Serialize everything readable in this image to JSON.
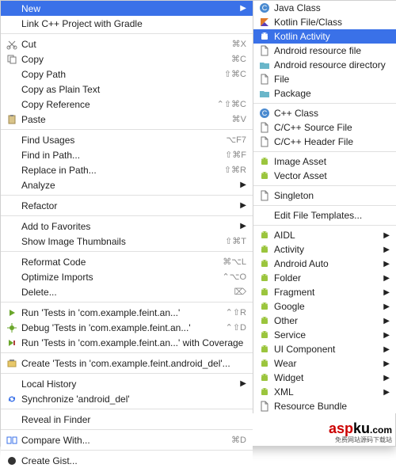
{
  "main": {
    "groups": [
      [
        {
          "key": "new",
          "label": "New",
          "icon": "blank",
          "highlight": true,
          "arrow": true
        },
        {
          "key": "link-cpp",
          "label": "Link C++ Project with Gradle",
          "icon": "blank"
        }
      ],
      [
        {
          "key": "cut",
          "label": "Cut",
          "icon": "scissors",
          "shortcut": "⌘X"
        },
        {
          "key": "copy",
          "label": "Copy",
          "icon": "copy",
          "shortcut": "⌘C"
        },
        {
          "key": "copy-path",
          "label": "Copy Path",
          "icon": "blank",
          "shortcut": "⇧⌘C"
        },
        {
          "key": "copy-plain",
          "label": "Copy as Plain Text",
          "icon": "blank"
        },
        {
          "key": "copy-ref",
          "label": "Copy Reference",
          "icon": "blank",
          "shortcut": "⌃⇧⌘C"
        },
        {
          "key": "paste",
          "label": "Paste",
          "icon": "paste",
          "shortcut": "⌘V"
        }
      ],
      [
        {
          "key": "find-usages",
          "label": "Find Usages",
          "icon": "blank",
          "shortcut": "⌥F7"
        },
        {
          "key": "find-in-path",
          "label": "Find in Path...",
          "icon": "blank",
          "shortcut": "⇧⌘F"
        },
        {
          "key": "replace-in-path",
          "label": "Replace in Path...",
          "icon": "blank",
          "shortcut": "⇧⌘R"
        },
        {
          "key": "analyze",
          "label": "Analyze",
          "icon": "blank",
          "arrow": true
        }
      ],
      [
        {
          "key": "refactor",
          "label": "Refactor",
          "icon": "blank",
          "arrow": true
        }
      ],
      [
        {
          "key": "fav",
          "label": "Add to Favorites",
          "icon": "blank",
          "arrow": true
        },
        {
          "key": "thumbs",
          "label": "Show Image Thumbnails",
          "icon": "blank",
          "shortcut": "⇧⌘T"
        }
      ],
      [
        {
          "key": "reformat",
          "label": "Reformat Code",
          "icon": "blank",
          "shortcut": "⌘⌥L"
        },
        {
          "key": "optimize",
          "label": "Optimize Imports",
          "icon": "blank",
          "shortcut": "⌃⌥O"
        },
        {
          "key": "delete",
          "label": "Delete...",
          "icon": "blank",
          "shortcut": "⌦"
        }
      ],
      [
        {
          "key": "run",
          "label": "Run 'Tests in 'com.example.feint.an...'",
          "icon": "run",
          "shortcut": "⌃⇧R"
        },
        {
          "key": "debug",
          "label": "Debug 'Tests in 'com.example.feint.an...'",
          "icon": "debug",
          "shortcut": "⌃⇧D"
        },
        {
          "key": "coverage",
          "label": "Run 'Tests in 'com.example.feint.an...' with Coverage",
          "icon": "coverage"
        }
      ],
      [
        {
          "key": "create-tests",
          "label": "Create 'Tests in 'com.example.feint.android_del'...",
          "icon": "create"
        }
      ],
      [
        {
          "key": "local-history",
          "label": "Local History",
          "icon": "blank",
          "arrow": true
        },
        {
          "key": "synchronize",
          "label": "Synchronize 'android_del'",
          "icon": "sync"
        }
      ],
      [
        {
          "key": "reveal",
          "label": "Reveal in Finder",
          "icon": "blank"
        }
      ],
      [
        {
          "key": "compare",
          "label": "Compare With...",
          "icon": "compare",
          "shortcut": "⌘D"
        }
      ],
      [
        {
          "key": "gist",
          "label": "Create Gist...",
          "icon": "gist"
        }
      ]
    ]
  },
  "sub": {
    "groups": [
      [
        {
          "key": "java-class",
          "label": "Java Class",
          "icon": "class-c"
        },
        {
          "key": "kotlin-file",
          "label": "Kotlin File/Class",
          "icon": "kotlin"
        },
        {
          "key": "kotlin-activity",
          "label": "Kotlin Activity",
          "icon": "android",
          "highlight": true
        },
        {
          "key": "res-file",
          "label": "Android resource file",
          "icon": "file"
        },
        {
          "key": "res-dir",
          "label": "Android resource directory",
          "icon": "folder"
        },
        {
          "key": "file",
          "label": "File",
          "icon": "file"
        },
        {
          "key": "package",
          "label": "Package",
          "icon": "folder"
        }
      ],
      [
        {
          "key": "cpp-class",
          "label": "C++ Class",
          "icon": "class-c"
        },
        {
          "key": "cpp-src",
          "label": "C/C++ Source File",
          "icon": "file"
        },
        {
          "key": "cpp-hdr",
          "label": "C/C++ Header File",
          "icon": "file"
        }
      ],
      [
        {
          "key": "image-asset",
          "label": "Image Asset",
          "icon": "android"
        },
        {
          "key": "vector-asset",
          "label": "Vector Asset",
          "icon": "android"
        }
      ],
      [
        {
          "key": "singleton",
          "label": "Singleton",
          "icon": "file"
        }
      ],
      [
        {
          "key": "edit-templates",
          "label": "Edit File Templates...",
          "icon": "blank"
        }
      ],
      [
        {
          "key": "aidl",
          "label": "AIDL",
          "icon": "android",
          "arrow": true
        },
        {
          "key": "activity",
          "label": "Activity",
          "icon": "android",
          "arrow": true
        },
        {
          "key": "android-auto",
          "label": "Android Auto",
          "icon": "android",
          "arrow": true
        },
        {
          "key": "folder",
          "label": "Folder",
          "icon": "android",
          "arrow": true
        },
        {
          "key": "fragment",
          "label": "Fragment",
          "icon": "android",
          "arrow": true
        },
        {
          "key": "google",
          "label": "Google",
          "icon": "android",
          "arrow": true
        },
        {
          "key": "other",
          "label": "Other",
          "icon": "android",
          "arrow": true
        },
        {
          "key": "service",
          "label": "Service",
          "icon": "android",
          "arrow": true
        },
        {
          "key": "ui-component",
          "label": "UI Component",
          "icon": "android",
          "arrow": true
        },
        {
          "key": "wear",
          "label": "Wear",
          "icon": "android",
          "arrow": true
        },
        {
          "key": "widget",
          "label": "Widget",
          "icon": "android",
          "arrow": true
        },
        {
          "key": "xml",
          "label": "XML",
          "icon": "android",
          "arrow": true
        },
        {
          "key": "res-bundle",
          "label": "Resource Bundle",
          "icon": "file"
        }
      ]
    ]
  },
  "watermark": {
    "brand1": "asp",
    "brand2": "ku",
    "suffix": ".com",
    "sub": "免费网站源码下载站"
  }
}
